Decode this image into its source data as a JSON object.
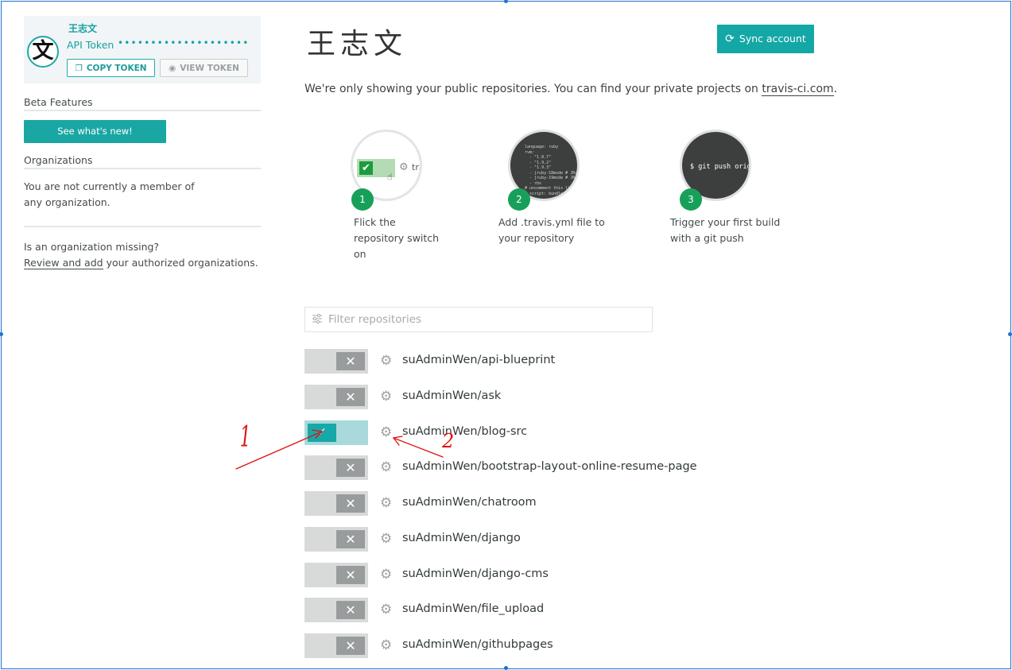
{
  "profile": {
    "avatar_char": "文",
    "name": "王志文",
    "token_label": "API Token",
    "token_masked": "••••••••••••••••••••",
    "copy_token": "COPY TOKEN",
    "view_token": "VIEW TOKEN"
  },
  "sidebar": {
    "beta_heading": "Beta Features",
    "beta_button": "See what's new!",
    "orgs_heading": "Organizations",
    "orgs_line1": "You are not currently a member of",
    "orgs_line2": "any organization.",
    "missing_q": "Is an organization missing?",
    "review_link": "Review and add",
    "review_rest": " your authorized organizations."
  },
  "header": {
    "title": "王志文",
    "sync_button": "Sync account",
    "notice_pre": "We're only showing your public repositories. You can find your private projects on ",
    "notice_link": "travis-ci.com",
    "notice_post": "."
  },
  "steps": [
    {
      "number": "1",
      "line1": "Flick the",
      "line2": "repository switch",
      "line3": "on",
      "mini_label": "tra"
    },
    {
      "number": "2",
      "line1": "Add .travis.yml file to",
      "line2": "your repository",
      "code": "language: ruby\nrvm:\n  - \"1.8.7\"\n  - \"1.9.2\"\n  - \"1.9.3\"\n  - jruby-18mode # JRuby\n  - jruby-19mode # JRuby\n  - rbx\n# uncomment this li\n# script: bundle"
    },
    {
      "number": "3",
      "line1": "Trigger your first build",
      "line2": "with a git push",
      "cmd": "$ git push origin"
    }
  ],
  "filter": {
    "placeholder": "Filter repositories"
  },
  "repos": [
    {
      "name": "suAdminWen/api-blueprint",
      "enabled": false
    },
    {
      "name": "suAdminWen/ask",
      "enabled": false
    },
    {
      "name": "suAdminWen/blog-src",
      "enabled": true
    },
    {
      "name": "suAdminWen/bootstrap-layout-online-resume-page",
      "enabled": false
    },
    {
      "name": "suAdminWen/chatroom",
      "enabled": false
    },
    {
      "name": "suAdminWen/django",
      "enabled": false
    },
    {
      "name": "suAdminWen/django-cms",
      "enabled": false
    },
    {
      "name": "suAdminWen/file_upload",
      "enabled": false
    },
    {
      "name": "suAdminWen/githubpages",
      "enabled": false
    }
  ],
  "annotations": {
    "label1": "1",
    "label2": "2",
    "color": "#e01010"
  },
  "colors": {
    "accent": "#13a7a5",
    "step_green": "#18a05a",
    "frame": "#1e73cf"
  }
}
